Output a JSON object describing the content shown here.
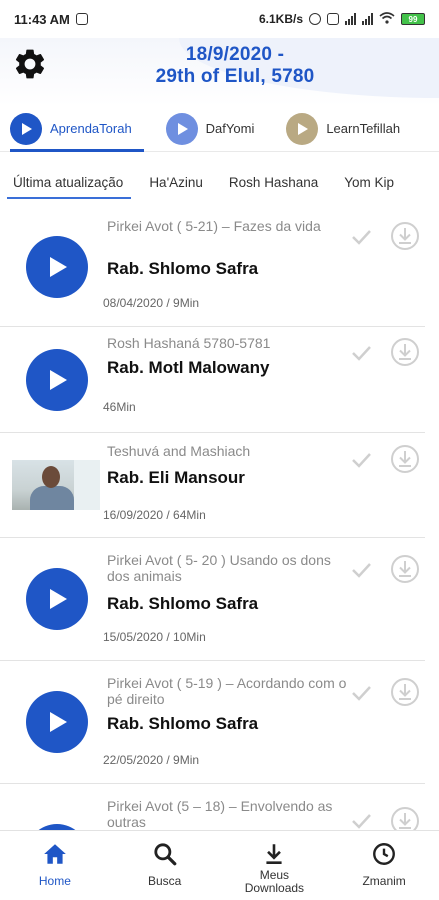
{
  "status_bar": {
    "time": "11:43 AM",
    "speed": "6.1KB/s",
    "battery": "99"
  },
  "header": {
    "date_line1": "18/9/2020 -",
    "date_line2": "29th of Elul, 5780"
  },
  "channels": [
    {
      "label": "AprendaTorah",
      "color": "#1f56c6"
    },
    {
      "label": "DafYomi",
      "color": "#6f8fe0"
    },
    {
      "label": "LearnTefillah",
      "color": "#b9a983"
    }
  ],
  "tabs": [
    "Última atualização",
    "Ha'Azinu",
    "Rosh Hashana",
    "Yom Kip"
  ],
  "items": [
    {
      "subtitle": "Pirkei Avot ( 5-21) – Fazes da vida",
      "speaker": "Rab. Shlomo Safra",
      "meta": "08/04/2020 / 9Min"
    },
    {
      "subtitle": "Rosh Hashaná 5780-5781",
      "speaker": "Rab. Motl Malowany",
      "meta": "46Min"
    },
    {
      "subtitle": "Teshuvá and Mashiach",
      "speaker": "Rab. Eli Mansour",
      "meta": "16/09/2020 / 64Min"
    },
    {
      "subtitle": "Pirkei Avot ( 5- 20 ) Usando os dons dos animais",
      "speaker": "Rab. Shlomo Safra",
      "meta": "15/05/2020 / 10Min"
    },
    {
      "subtitle": "Pirkei Avot ( 5-19 ) – Acordando com o pé direito",
      "speaker": "Rab. Shlomo Safra",
      "meta": "22/05/2020 / 9Min"
    },
    {
      "subtitle": "Pirkei Avot (5 – 18) – Envolvendo as outras",
      "speaker": "",
      "meta": ""
    }
  ],
  "bottom_nav": [
    {
      "label": "Home",
      "icon": "home-icon"
    },
    {
      "label": "Busca",
      "icon": "search-icon"
    },
    {
      "label": "Meus Downloads",
      "icon": "download-icon"
    },
    {
      "label": "Zmanim",
      "icon": "clock-icon"
    }
  ],
  "colors": {
    "accent": "#1f56c6"
  }
}
